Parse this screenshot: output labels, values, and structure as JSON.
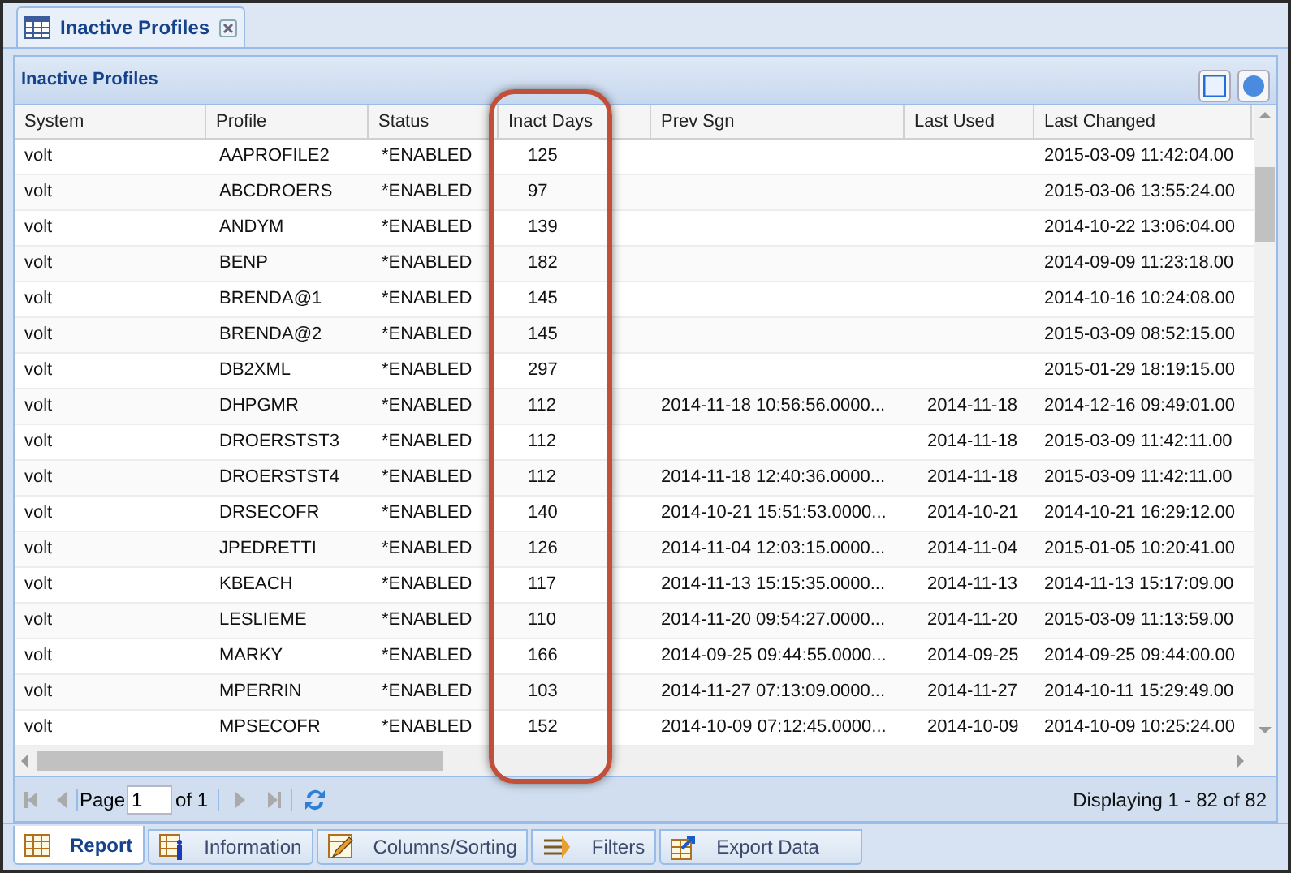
{
  "tab": {
    "title": "Inactive Profiles"
  },
  "panel": {
    "title": "Inactive Profiles"
  },
  "table": {
    "columns": [
      "System",
      "Profile",
      "Status",
      "Inact Days",
      "Prev Sgn",
      "Last Used",
      "Last Changed"
    ],
    "rows": [
      [
        "volt",
        "AAPROFILE2",
        "*ENABLED",
        "125",
        "",
        "",
        "2015-03-09 11:42:04.00"
      ],
      [
        "volt",
        "ABCDROERS",
        "*ENABLED",
        "97",
        "",
        "",
        "2015-03-06 13:55:24.00"
      ],
      [
        "volt",
        "ANDYM",
        "*ENABLED",
        "139",
        "",
        "",
        "2014-10-22 13:06:04.00"
      ],
      [
        "volt",
        "BENP",
        "*ENABLED",
        "182",
        "",
        "",
        "2014-09-09 11:23:18.00"
      ],
      [
        "volt",
        "BRENDA@1",
        "*ENABLED",
        "145",
        "",
        "",
        "2014-10-16 10:24:08.00"
      ],
      [
        "volt",
        "BRENDA@2",
        "*ENABLED",
        "145",
        "",
        "",
        "2015-03-09 08:52:15.00"
      ],
      [
        "volt",
        "DB2XML",
        "*ENABLED",
        "297",
        "",
        "",
        "2015-01-29 18:19:15.00"
      ],
      [
        "volt",
        "DHPGMR",
        "*ENABLED",
        "112",
        "2014-11-18 10:56:56.0000...",
        "2014-11-18",
        "2014-12-16 09:49:01.00"
      ],
      [
        "volt",
        "DROERSTST3",
        "*ENABLED",
        "112",
        "",
        "2014-11-18",
        "2015-03-09 11:42:11.00"
      ],
      [
        "volt",
        "DROERSTST4",
        "*ENABLED",
        "112",
        "2014-11-18 12:40:36.0000...",
        "2014-11-18",
        "2015-03-09 11:42:11.00"
      ],
      [
        "volt",
        "DRSECOFR",
        "*ENABLED",
        "140",
        "2014-10-21 15:51:53.0000...",
        "2014-10-21",
        "2014-10-21 16:29:12.00"
      ],
      [
        "volt",
        "JPEDRETTI",
        "*ENABLED",
        "126",
        "2014-11-04 12:03:15.0000...",
        "2014-11-04",
        "2015-01-05 10:20:41.00"
      ],
      [
        "volt",
        "KBEACH",
        "*ENABLED",
        "117",
        "2014-11-13 15:15:35.0000...",
        "2014-11-13",
        "2014-11-13 15:17:09.00"
      ],
      [
        "volt",
        "LESLIEME",
        "*ENABLED",
        "110",
        "2014-11-20 09:54:27.0000...",
        "2014-11-20",
        "2015-03-09 11:13:59.00"
      ],
      [
        "volt",
        "MARKY",
        "*ENABLED",
        "166",
        "2014-09-25 09:44:55.0000...",
        "2014-09-25",
        "2014-09-25 09:44:00.00"
      ],
      [
        "volt",
        "MPERRIN",
        "*ENABLED",
        "103",
        "2014-11-27 07:13:09.0000...",
        "2014-11-27",
        "2014-10-11 15:29:49.00"
      ],
      [
        "volt",
        "MPSECOFR",
        "*ENABLED",
        "152",
        "2014-10-09 07:12:45.0000...",
        "2014-10-09",
        "2014-10-09 10:25:24.00"
      ]
    ]
  },
  "pager": {
    "page_label": "Page",
    "page": "1",
    "of_label": "of 1",
    "summary": "Displaying 1 - 82 of 82"
  },
  "bottom_tabs": [
    {
      "label": "Report",
      "selected": true
    },
    {
      "label": "Information",
      "selected": false
    },
    {
      "label": "Columns/Sorting",
      "selected": false
    },
    {
      "label": "Filters",
      "selected": false
    },
    {
      "label": "Export Data",
      "selected": false
    }
  ]
}
